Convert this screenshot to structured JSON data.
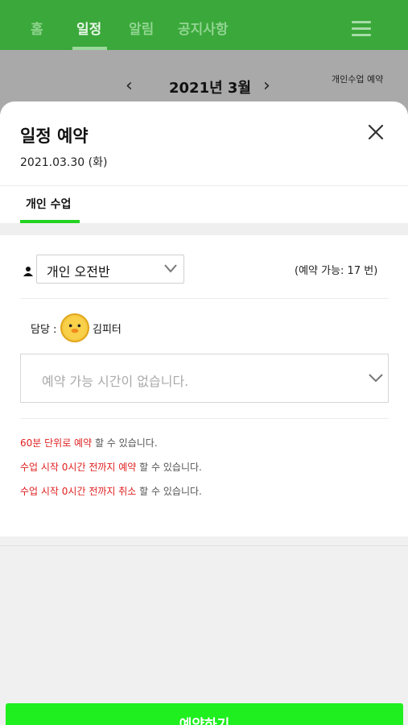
{
  "nav": {
    "items": [
      {
        "label": "홈"
      },
      {
        "label": "일정",
        "active": true
      },
      {
        "label": "알림"
      },
      {
        "label": "공지사항"
      }
    ],
    "menu_icon": "hamburger-icon"
  },
  "calendar": {
    "month_label": "2021년 3월",
    "prev_icon": "chevron-left-icon",
    "next_icon": "chevron-right-icon",
    "private_link": "개인수업 예약"
  },
  "sheet": {
    "title": "일정 예약",
    "date": "2021.03.30 (화)",
    "close_icon": "close-icon",
    "tabs": [
      {
        "label": "개인 수업",
        "active": true
      }
    ]
  },
  "booking": {
    "class_select_value": "개인 오전반",
    "availability": "(예약 가능: 17 번)",
    "instructor_label": "담당 :",
    "instructor_name": "김피터",
    "time_placeholder": "예약 가능 시간이 없습니다."
  },
  "notes": [
    {
      "highlight": "60분 단위로 예약",
      "rest": " 할 수 있습니다."
    },
    {
      "highlight": "수업 시작 0시간 전까지 예약",
      "rest": " 할 수 있습니다."
    },
    {
      "highlight": "수업 시작 0시간 전까지 취소",
      "rest": " 할 수 있습니다."
    }
  ],
  "footer": {
    "submit_label": "예약하기"
  },
  "colors": {
    "brand_green": "#3aa83a",
    "accent_green": "#22d322",
    "button_green": "#1fef1f",
    "highlight_red": "#e02020"
  }
}
